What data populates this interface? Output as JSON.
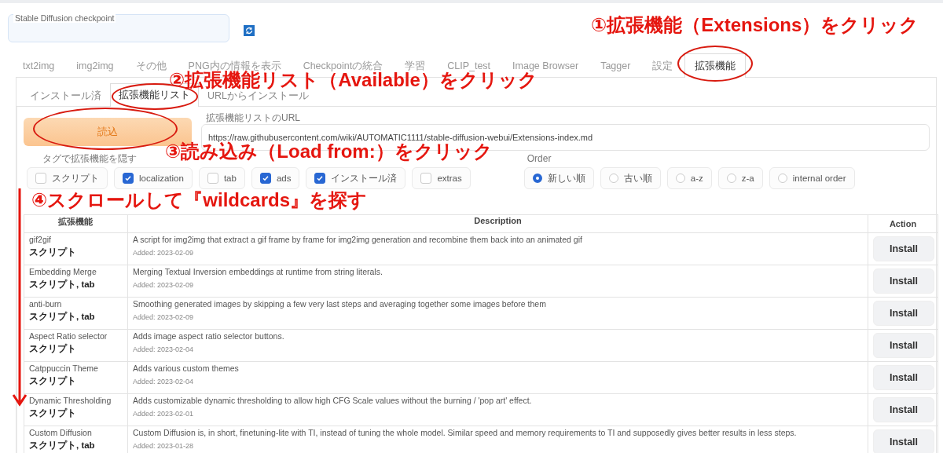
{
  "checkpoint": {
    "label": "Stable Diffusion checkpoint"
  },
  "tabs": [
    {
      "label": "txt2img",
      "selected": false
    },
    {
      "label": "img2img",
      "selected": false
    },
    {
      "label": "その他",
      "selected": false
    },
    {
      "label": "PNG内の情報を表示",
      "selected": false
    },
    {
      "label": "Checkpointの統合",
      "selected": false
    },
    {
      "label": "学習",
      "selected": false
    },
    {
      "label": "CLIP_test",
      "selected": false
    },
    {
      "label": "Image Browser",
      "selected": false
    },
    {
      "label": "Tagger",
      "selected": false
    },
    {
      "label": "設定",
      "selected": false
    },
    {
      "label": "拡張機能",
      "selected": true
    }
  ],
  "subtabs": [
    {
      "label": "インストール済",
      "selected": false
    },
    {
      "label": "拡張機能リスト",
      "selected": true
    },
    {
      "label": "URLからインストール",
      "selected": false
    }
  ],
  "load_button": "読込",
  "url_field": {
    "label": "拡張機能リストのURL",
    "value": "https://raw.githubusercontent.com/wiki/AUTOMATIC1111/stable-diffusion-webui/Extensions-index.md"
  },
  "hide_tags": {
    "label": "タグで拡張機能を隠す",
    "options": [
      {
        "label": "スクリプト",
        "checked": false
      },
      {
        "label": "localization",
        "checked": true
      },
      {
        "label": "tab",
        "checked": false
      },
      {
        "label": "ads",
        "checked": true
      },
      {
        "label": "インストール済",
        "checked": true
      },
      {
        "label": "extras",
        "checked": false
      }
    ]
  },
  "order": {
    "label": "Order",
    "options": [
      {
        "label": "新しい順",
        "selected": true
      },
      {
        "label": "古い順",
        "selected": false
      },
      {
        "label": "a-z",
        "selected": false
      },
      {
        "label": "z-a",
        "selected": false
      },
      {
        "label": "internal order",
        "selected": false
      }
    ]
  },
  "table": {
    "columns": [
      "拡張機能",
      "Description",
      "Action"
    ],
    "rows": [
      {
        "name": "gif2gif",
        "tags": "スクリプト",
        "description": "A script for img2img that extract a gif frame by frame for img2img generation and recombine them back into an animated gif",
        "added": "Added: 2023-02-09",
        "action": "Install"
      },
      {
        "name": "Embedding Merge",
        "tags": "スクリプト, tab",
        "description": "Merging Textual Inversion embeddings at runtime from string literals.",
        "added": "Added: 2023-02-09",
        "action": "Install"
      },
      {
        "name": "anti-burn",
        "tags": "スクリプト, tab",
        "description": "Smoothing generated images by skipping a few very last steps and averaging together some images before them",
        "added": "Added: 2023-02-09",
        "action": "Install"
      },
      {
        "name": "Aspect Ratio selector",
        "tags": "スクリプト",
        "description": "Adds image aspect ratio selector buttons.",
        "added": "Added: 2023-02-04",
        "action": "Install"
      },
      {
        "name": "Catppuccin Theme",
        "tags": "スクリプト",
        "description": "Adds various custom themes",
        "added": "Added: 2023-02-04",
        "action": "Install"
      },
      {
        "name": "Dynamic Thresholding",
        "tags": "スクリプト",
        "description": "Adds customizable dynamic thresholding to allow high CFG Scale values without the burning / 'pop art' effect.",
        "added": "Added: 2023-02-01",
        "action": "Install"
      },
      {
        "name": "Custom Diffusion",
        "tags": "スクリプト, tab",
        "description": "Custom Diffusion is, in short, finetuning-lite with TI, instead of tuning the whole model. Similar speed and memory requirements to TI and supposedly gives better results in less steps.",
        "added": "Added: 2023-01-28",
        "action": "Install"
      }
    ]
  },
  "annotations": [
    {
      "text": "①拡張機能（Extensions）をクリック"
    },
    {
      "text": "②拡張機能リスト（Available）をクリック"
    },
    {
      "text": "③読み込み（Load from:）をクリック"
    },
    {
      "text": "④スクロールして『wildcards』を探す"
    }
  ]
}
